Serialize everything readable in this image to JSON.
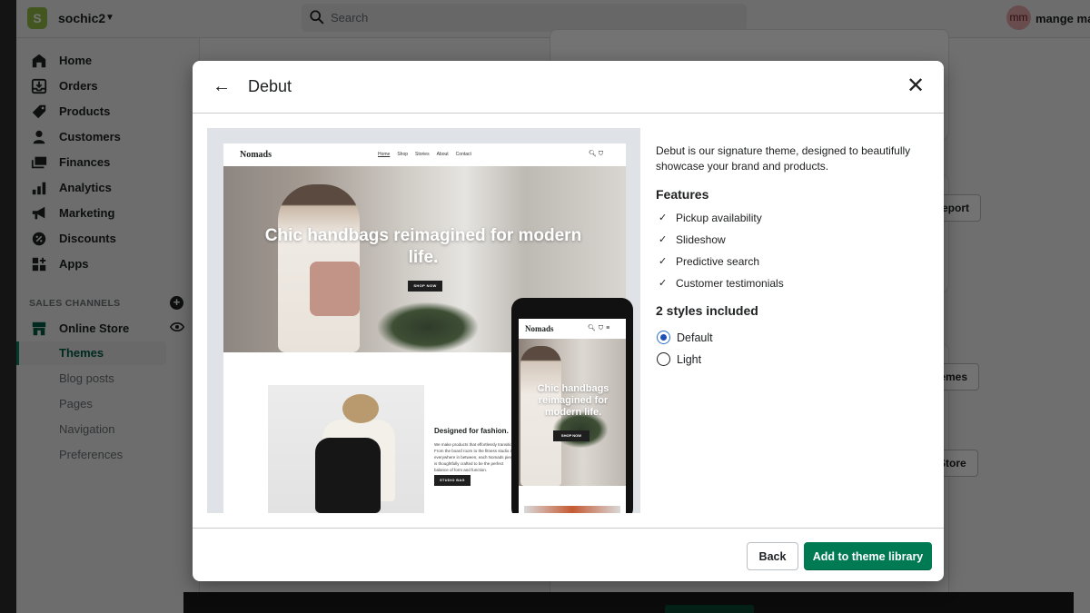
{
  "topbar": {
    "store_name": "sochic2",
    "search_placeholder": "Search",
    "avatar_initials": "mm",
    "user_name": "mange ma"
  },
  "sidebar": {
    "items": [
      {
        "label": "Home",
        "icon": "home-icon"
      },
      {
        "label": "Orders",
        "icon": "orders-icon"
      },
      {
        "label": "Products",
        "icon": "tag-icon"
      },
      {
        "label": "Customers",
        "icon": "person-icon"
      },
      {
        "label": "Finances",
        "icon": "finances-icon"
      },
      {
        "label": "Analytics",
        "icon": "bar-chart-icon"
      },
      {
        "label": "Marketing",
        "icon": "megaphone-icon"
      },
      {
        "label": "Discounts",
        "icon": "discount-icon"
      },
      {
        "label": "Apps",
        "icon": "apps-icon"
      }
    ],
    "section_label": "SALES CHANNELS",
    "channel": {
      "label": "Online Store",
      "icon": "store-icon"
    },
    "sub_items": [
      {
        "label": "Themes",
        "active": true
      },
      {
        "label": "Blog posts"
      },
      {
        "label": "Pages"
      },
      {
        "label": "Navigation"
      },
      {
        "label": "Preferences"
      }
    ]
  },
  "background": {
    "buttons": [
      "ew report",
      "themes",
      "e Store"
    ]
  },
  "modal": {
    "title": "Debut",
    "preview": {
      "desktop": {
        "logo": "Nomads",
        "nav_links": [
          "Home",
          "Shop",
          "Stories",
          "About",
          "Contact"
        ],
        "hero_title": "Chic handbags reimagined for modern life.",
        "hero_button": "SHOP NOW",
        "feature_title": "Designed for fashion.",
        "feature_text": "We make products that effortlessly transition. From the board room to the fitness studio and everywhere in between, each Nomads piece is thoughtfully crafted to be the perfect balance of form and function.",
        "feature_button": "STUDIO BAG"
      },
      "mobile": {
        "logo": "Nomads",
        "hero_title": "Chic handbags reimagined for modern life.",
        "hero_button": "SHOP NOW"
      }
    },
    "description": "Debut is our signature theme, designed to beautifully showcase your brand and products.",
    "features_heading": "Features",
    "features": [
      "Pickup availability",
      "Slideshow",
      "Predictive search",
      "Customer testimonials"
    ],
    "styles_heading": "2 styles included",
    "styles": [
      {
        "label": "Default",
        "selected": true
      },
      {
        "label": "Light",
        "selected": false
      }
    ],
    "footer": {
      "back_label": "Back",
      "primary_label": "Add to theme library"
    }
  },
  "colors": {
    "primary": "#007a52",
    "radio_selected": "#1f4eb5",
    "shopify_green": "#95bf47",
    "active_nav": "#008060"
  }
}
